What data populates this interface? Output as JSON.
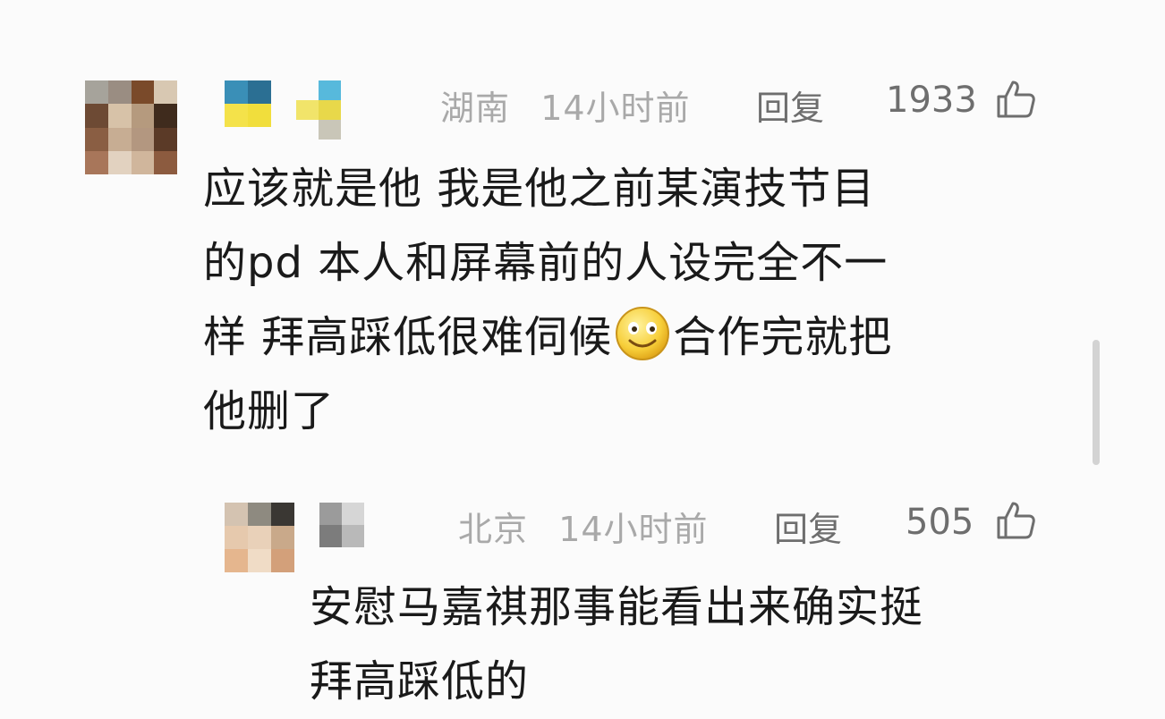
{
  "comment": {
    "location": "湖南",
    "time": "14小时前",
    "reply_label": "回复",
    "likes": "1933",
    "lines": [
      "应该就是他 我是他之前某演技节目",
      "的pd 本人和屏幕前的人设完全不一",
      "样 拜高踩低很难伺候",
      "合作完就把",
      "他删了"
    ],
    "emoji": "smiley-face-icon"
  },
  "reply": {
    "location": "北京",
    "time": "14小时前",
    "reply_label": "回复",
    "likes": "505",
    "lines": [
      "安慰马嘉祺那事能看出来确实挺",
      "拜高踩低的"
    ]
  },
  "colors": {
    "meta": "#a9a9a9",
    "action": "#6e6e6e",
    "text": "#1a1a1a",
    "background": "#fbfbfb"
  }
}
